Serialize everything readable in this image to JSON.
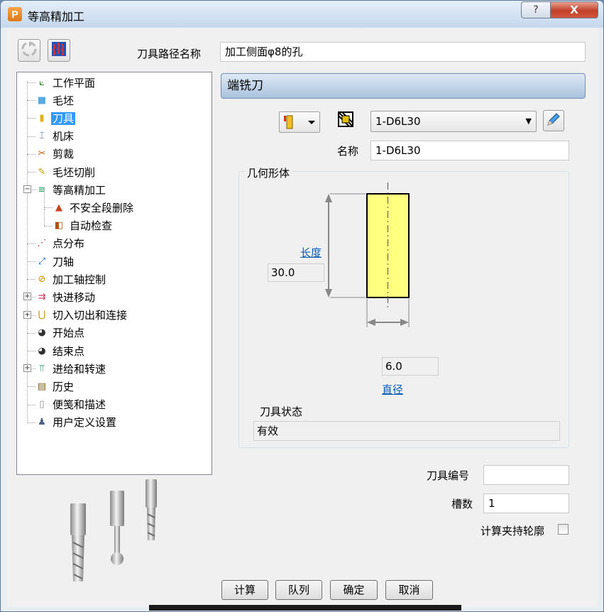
{
  "window": {
    "title": "等高精加工",
    "app_icon_letter": "P",
    "help_label": "?",
    "close_label": "X"
  },
  "toolpath_name": {
    "label": "刀具路径名称",
    "value": "加工侧面φ8的孔"
  },
  "tree": {
    "items": [
      {
        "label": "工作平面",
        "icon": "workplane-icon",
        "glyph": "⟀",
        "color": "#3a8a3a"
      },
      {
        "label": "毛坯",
        "icon": "block-icon",
        "glyph": "■",
        "color": "#5aa8e0"
      },
      {
        "label": "刀具",
        "icon": "tool-icon",
        "glyph": "▮",
        "color": "#e0b020",
        "selected": true
      },
      {
        "label": "机床",
        "icon": "machine-icon",
        "glyph": "⌶",
        "color": "#4a6aa0"
      },
      {
        "label": "剪裁",
        "icon": "trim-icon",
        "glyph": "✂",
        "color": "#c06000"
      },
      {
        "label": "毛坯切削",
        "icon": "stock-cut-icon",
        "glyph": "✎",
        "color": "#c0a000"
      },
      {
        "label": "等高精加工",
        "icon": "constant-z-icon",
        "glyph": "≡",
        "color": "#2aa060",
        "expander": "−"
      },
      {
        "label": "不安全段删除",
        "icon": "unsafe-segment-icon",
        "glyph": "▲",
        "color": "#d04020",
        "indent": 1
      },
      {
        "label": "自动检查",
        "icon": "auto-check-icon",
        "glyph": "◧",
        "color": "#b05010",
        "indent": 1
      },
      {
        "label": "点分布",
        "icon": "point-distribution-icon",
        "glyph": "⋰",
        "color": "#c03030"
      },
      {
        "label": "刀轴",
        "icon": "tool-axis-icon",
        "glyph": "⤢",
        "color": "#3070c0"
      },
      {
        "label": "加工轴控制",
        "icon": "axis-control-icon",
        "glyph": "⊘",
        "color": "#e09000"
      },
      {
        "label": "快进移动",
        "icon": "rapid-move-icon",
        "glyph": "⇉",
        "color": "#d03050",
        "expander": "+"
      },
      {
        "label": "切入切出和连接",
        "icon": "lead-in-out-icon",
        "glyph": "⋃",
        "color": "#c09000",
        "expander": "+"
      },
      {
        "label": "开始点",
        "icon": "start-point-icon",
        "glyph": "◕",
        "color": "#303030"
      },
      {
        "label": "结束点",
        "icon": "end-point-icon",
        "glyph": "◕",
        "color": "#303030"
      },
      {
        "label": "进给和转速",
        "icon": "feeds-speeds-icon",
        "glyph": "⫪",
        "color": "#208060",
        "expander": "+"
      },
      {
        "label": "历史",
        "icon": "history-icon",
        "glyph": "▤",
        "color": "#806020"
      },
      {
        "label": "便笺和描述",
        "icon": "notes-icon",
        "glyph": "▯",
        "color": "#909090"
      },
      {
        "label": "用户定义设置",
        "icon": "user-settings-icon",
        "glyph": "♟",
        "color": "#506080"
      }
    ]
  },
  "section_title": "端铣刀",
  "tool_selector": {
    "value": "1-D6L30"
  },
  "tool_name": {
    "label": "名称",
    "value": "1-D6L30"
  },
  "geometry": {
    "title": "几何形体",
    "length_label": "长度",
    "length_value": "30.0",
    "diameter_label": "直径",
    "diameter_value": "6.0",
    "tool_body_color": "#ffff80"
  },
  "tool_state": {
    "label": "刀具状态",
    "value": "有效"
  },
  "tool_number": {
    "label": "刀具编号",
    "value": ""
  },
  "flutes": {
    "label": "槽数",
    "value": "1"
  },
  "holder_profile": {
    "label": "计算夹持轮廓"
  },
  "buttons": {
    "calculate": "计算",
    "queue": "队列",
    "ok": "确定",
    "cancel": "取消"
  }
}
